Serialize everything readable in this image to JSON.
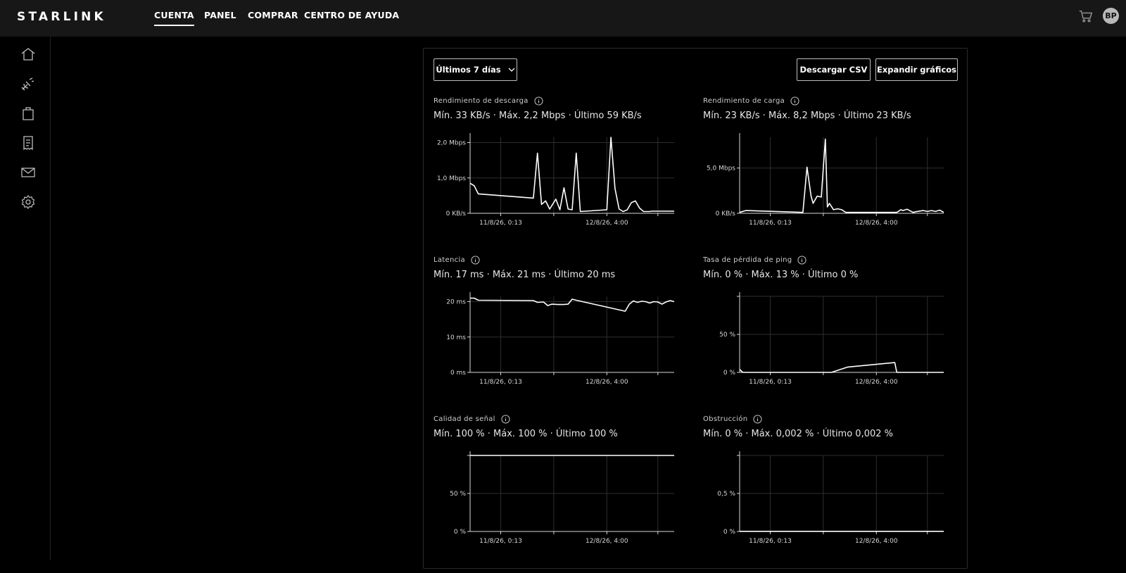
{
  "header": {
    "logo": "STARLINK",
    "nav": [
      {
        "label": "CUENTA",
        "active": true
      },
      {
        "label": "PANEL",
        "active": false
      },
      {
        "label": "COMPRAR",
        "active": false
      },
      {
        "label": "CENTRO DE AYUDA",
        "active": false
      }
    ],
    "cart_icon": "cart-icon",
    "avatar_initials": "BP"
  },
  "sidebar": {
    "items": [
      "home-icon",
      "satellite-dish-icon",
      "shopping-bag-icon",
      "receipt-icon",
      "mail-icon",
      "settings-gear-icon"
    ]
  },
  "toolbar": {
    "range_select": "Últimos 7 días",
    "download_label": "Descargar CSV",
    "expand_label": "Expandir gráficos"
  },
  "charts": [
    {
      "title": "Rendimiento de descarga",
      "stats": "Mín. 33 KB/s · Máx. 2,2 Mbps · Último 59 KB/s"
    },
    {
      "title": "Rendimiento de carga",
      "stats": "Mín. 23 KB/s · Máx. 8,2 Mbps · Último 23 KB/s"
    },
    {
      "title": "Latencia",
      "stats": "Mín. 17 ms · Máx. 21 ms · Último 20 ms"
    },
    {
      "title": "Tasa de pérdida de ping",
      "stats": "Mín. 0 % · Máx. 13 % · Último 0 %"
    },
    {
      "title": "Calidad de señal",
      "stats": "Mín. 100 % · Máx. 100 % · Último 100 %"
    },
    {
      "title": "Obstrucción",
      "stats": "Mín. 0 % · Máx. 0,002 % · Último 0,002 %"
    }
  ],
  "chart_data": [
    {
      "type": "line",
      "title": "Rendimiento de descarga",
      "unit": "Mbps",
      "yticks": [
        {
          "value": 0,
          "label": "0 KB/s"
        },
        {
          "value": 1.0,
          "label": "1,0 Mbps"
        },
        {
          "value": 2.0,
          "label": "2,0 Mbps"
        }
      ],
      "ylim": [
        0,
        2.15
      ],
      "xticks": [
        "11/8/26, 0:13",
        "12/8/26, 4:00"
      ],
      "x": [
        0,
        2,
        4,
        31,
        33,
        35,
        37,
        39,
        42,
        44,
        46,
        48,
        50,
        52,
        54,
        67,
        69,
        71,
        73,
        75,
        77,
        79,
        81,
        83,
        85,
        86,
        87,
        88,
        89,
        100
      ],
      "values": [
        0.85,
        0.78,
        0.55,
        0.43,
        1.7,
        0.25,
        0.35,
        0.12,
        0.4,
        0.1,
        0.72,
        0.12,
        0.1,
        1.7,
        0.05,
        0.1,
        2.15,
        0.7,
        0.12,
        0.05,
        0.1,
        0.3,
        0.35,
        0.15,
        0.05,
        0.05,
        0.05,
        0.05,
        0.06,
        0.06
      ]
    },
    {
      "type": "line",
      "title": "Rendimiento de carga",
      "unit": "Mbps",
      "yticks": [
        {
          "value": 0,
          "label": "0 KB/s"
        },
        {
          "value": 5.0,
          "label": "5,0 Mbps"
        }
      ],
      "ylim": [
        0,
        8.4
      ],
      "xticks": [
        "11/8/26, 0:13",
        "12/8/26, 4:00"
      ],
      "x": [
        0,
        3,
        31,
        33,
        35,
        36,
        38,
        40,
        42,
        43,
        44,
        46,
        48,
        50,
        52,
        77,
        79,
        80,
        82,
        85,
        87,
        90,
        92,
        94,
        96,
        98,
        100
      ],
      "values": [
        0.1,
        0.3,
        0.1,
        5.1,
        1.9,
        1.1,
        1.9,
        1.8,
        8.2,
        0.7,
        1.1,
        0.4,
        0.5,
        0.4,
        0.1,
        0.1,
        0.4,
        0.3,
        0.45,
        0.1,
        0.2,
        0.3,
        0.2,
        0.3,
        0.2,
        0.35,
        0.1
      ]
    },
    {
      "type": "line",
      "title": "Latencia",
      "unit": "ms",
      "yticks": [
        {
          "value": 0,
          "label": "0 ms"
        },
        {
          "value": 10,
          "label": "10 ms"
        },
        {
          "value": 20,
          "label": "20 ms"
        }
      ],
      "ylim": [
        0,
        21.5
      ],
      "xticks": [
        "11/8/26, 0:13",
        "12/8/26, 4:00"
      ],
      "x": [
        0,
        2,
        4,
        31,
        33,
        36,
        38,
        40,
        43,
        46,
        48,
        50,
        52,
        76,
        78,
        80,
        82,
        84,
        86,
        88,
        90,
        92,
        94,
        96,
        98,
        100
      ],
      "values": [
        21,
        21,
        20.4,
        20.3,
        19.8,
        19.9,
        18.9,
        19.3,
        19.2,
        19.2,
        19.3,
        20.7,
        20.4,
        17.3,
        19.3,
        20.2,
        19.8,
        20.1,
        20.0,
        19.6,
        20.0,
        19.9,
        19.3,
        19.9,
        20.3,
        20.0
      ]
    },
    {
      "type": "line",
      "title": "Tasa de pérdida de ping",
      "unit": "%",
      "yticks": [
        {
          "value": 0,
          "label": "0 %"
        },
        {
          "value": 50,
          "label": "50 %"
        },
        {
          "value": 100,
          "label": ""
        }
      ],
      "ylim": [
        0,
        100
      ],
      "xticks": [
        "11/8/26, 0:13",
        "12/8/26, 4:00"
      ],
      "x": [
        0,
        1.5,
        45,
        53,
        76,
        77,
        100
      ],
      "values": [
        4,
        0,
        0,
        7,
        13,
        0,
        0
      ]
    },
    {
      "type": "line",
      "title": "Calidad de señal",
      "unit": "%",
      "yticks": [
        {
          "value": 0,
          "label": "0 %"
        },
        {
          "value": 50,
          "label": "50 %"
        },
        {
          "value": 100,
          "label": ""
        }
      ],
      "ylim": [
        0,
        100
      ],
      "xticks": [
        "11/8/26, 0:13",
        "12/8/26, 4:00"
      ],
      "x": [
        0,
        100
      ],
      "values": [
        100,
        100
      ]
    },
    {
      "type": "line",
      "title": "Obstrucción",
      "unit": "%",
      "yticks": [
        {
          "value": 0,
          "label": "0 %"
        },
        {
          "value": 0.5,
          "label": "0,5 %"
        },
        {
          "value": 1.0,
          "label": ""
        }
      ],
      "ylim": [
        0,
        1.0
      ],
      "xticks": [
        "11/8/26, 0:13",
        "12/8/26, 4:00"
      ],
      "x": [
        0,
        100
      ],
      "values": [
        0.002,
        0.002
      ]
    }
  ]
}
